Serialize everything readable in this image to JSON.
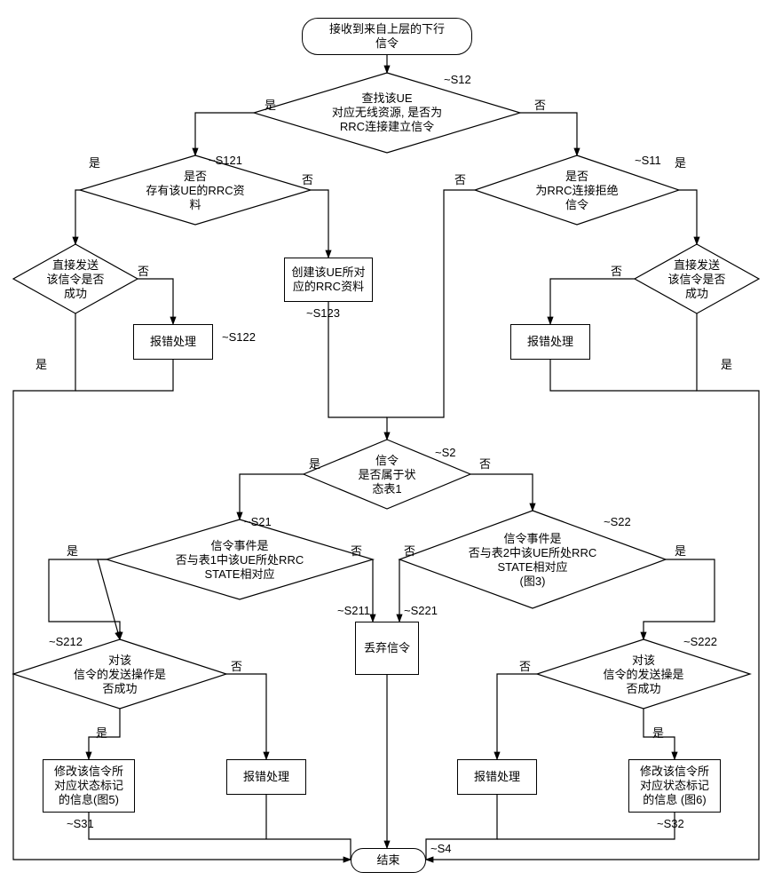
{
  "start": "接收到来自上层的下行\n信令",
  "s12": {
    "label": "~S12",
    "text": "查找该UE\n对应无线资源, 是否为\nRRC连接建立信令"
  },
  "s121": {
    "label": "~S121",
    "text": "是否\n存有该UE的RRC资\n料"
  },
  "s11": {
    "label": "~S11",
    "text": "是否\n为RRC连接拒绝\n信令"
  },
  "s123": {
    "label": "~S123",
    "text": "创建该UE所对\n应的RRC资料"
  },
  "s122": {
    "label": "~S122",
    "text": "报错处理"
  },
  "left_send": "直接发送\n该信令是否\n成功",
  "right_send": "直接发送\n该信令是否\n成功",
  "right_err": "报错处理",
  "s2": {
    "label": "~S2",
    "text": "信令\n是否属于状\n态表1"
  },
  "s21": {
    "label": "~S21",
    "text": "信令事件是\n否与表1中该UE所处RRC\nSTATE相对应"
  },
  "s22": {
    "label": "~S22",
    "text": "信令事件是\n否与表2中该UE所处RRC\nSTATE相对应\n(图3)"
  },
  "s211_221": {
    "label_l": "~S211",
    "label_r": "~S221",
    "text": "丢弃信令"
  },
  "s212": {
    "label": "~S212",
    "text": "对该\n信令的发送操作是\n否成功"
  },
  "s222": {
    "label": "~S222",
    "text": "对该\n信令的发送操是\n否成功"
  },
  "s31": {
    "label": "~S31",
    "text": "修改该信令所\n对应状态标记\n的信息(图5)"
  },
  "s32": {
    "label": "~S32",
    "text": "修改该信令所\n对应状态标记\n的信息 (图6)"
  },
  "s212_err": "报错处理",
  "s222_err": "报错处理",
  "s4": {
    "label": "~S4",
    "text": "结束"
  },
  "yes": "是",
  "no": "否"
}
